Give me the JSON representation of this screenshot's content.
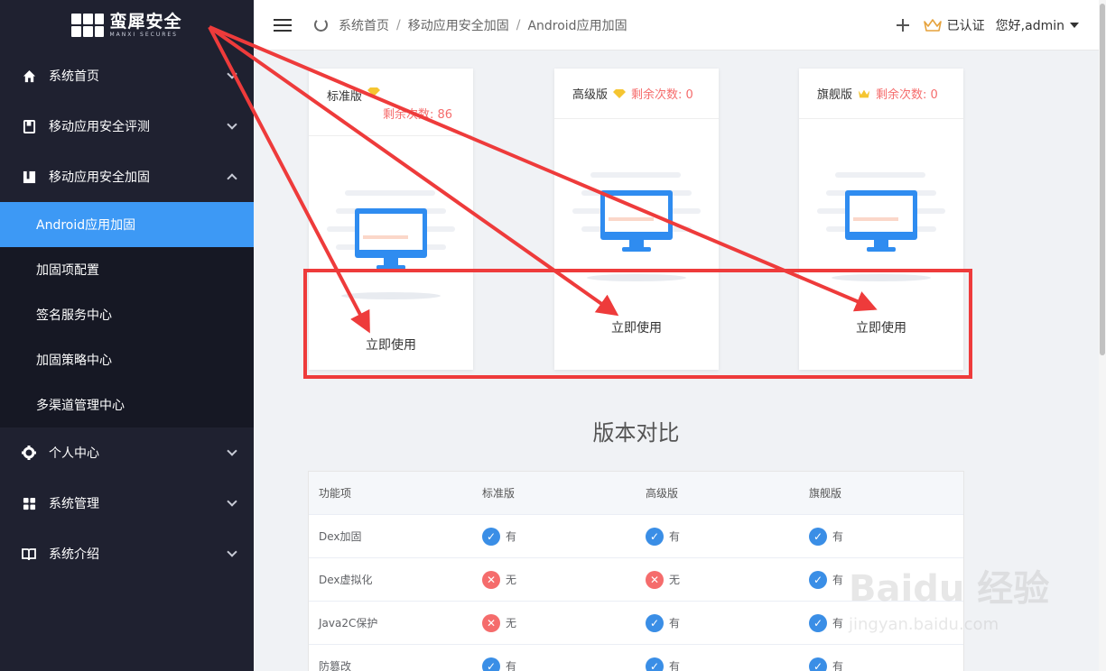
{
  "brand": {
    "name_cn": "蛮犀安全",
    "name_en": "MANXI SECURES"
  },
  "sidebar": {
    "items": [
      {
        "label": "系统首页"
      },
      {
        "label": "移动应用安全评测"
      },
      {
        "label": "移动应用安全加固",
        "expanded": true,
        "children": [
          {
            "label": "Android应用加固",
            "active": true
          },
          {
            "label": "加固项配置"
          },
          {
            "label": "签名服务中心"
          },
          {
            "label": "加固策略中心"
          },
          {
            "label": "多渠道管理中心"
          }
        ]
      },
      {
        "label": "个人中心"
      },
      {
        "label": "系统管理"
      },
      {
        "label": "系统介绍"
      }
    ]
  },
  "header": {
    "breadcrumb": [
      "系统首页",
      "移动应用安全加固",
      "Android应用加固"
    ],
    "verified": "已认证",
    "greeting": "您好,admin"
  },
  "plans": [
    {
      "name": "标准版",
      "remain": "剩余次数: 86",
      "action": "立即使用"
    },
    {
      "name": "高级版",
      "remain": "剩余次数: 0",
      "action": "立即使用"
    },
    {
      "name": "旗舰版",
      "remain": "剩余次数: 0",
      "action": "立即使用"
    }
  ],
  "compare": {
    "title": "版本对比",
    "headers": [
      "功能项",
      "标准版",
      "高级版",
      "旗舰版"
    ],
    "rows": [
      {
        "feature": "Dex加固",
        "std": "有",
        "adv": "有",
        "flag": "有"
      },
      {
        "feature": "Dex虚拟化",
        "std": "无",
        "adv": "无",
        "flag": "有"
      },
      {
        "feature": "Java2C保护",
        "std": "无",
        "adv": "有",
        "flag": "有"
      },
      {
        "feature": "防篡改",
        "std": "有",
        "adv": "有",
        "flag": "有"
      }
    ]
  },
  "watermark": {
    "brand": "Baidu 经验",
    "url": "jingyan.baidu.com"
  },
  "colors": {
    "sidebar_bg": "#1f2130",
    "active": "#3d99f5",
    "yes": "#3a8ee6",
    "no": "#f56c6c",
    "annotation": "#ee3b3b"
  }
}
